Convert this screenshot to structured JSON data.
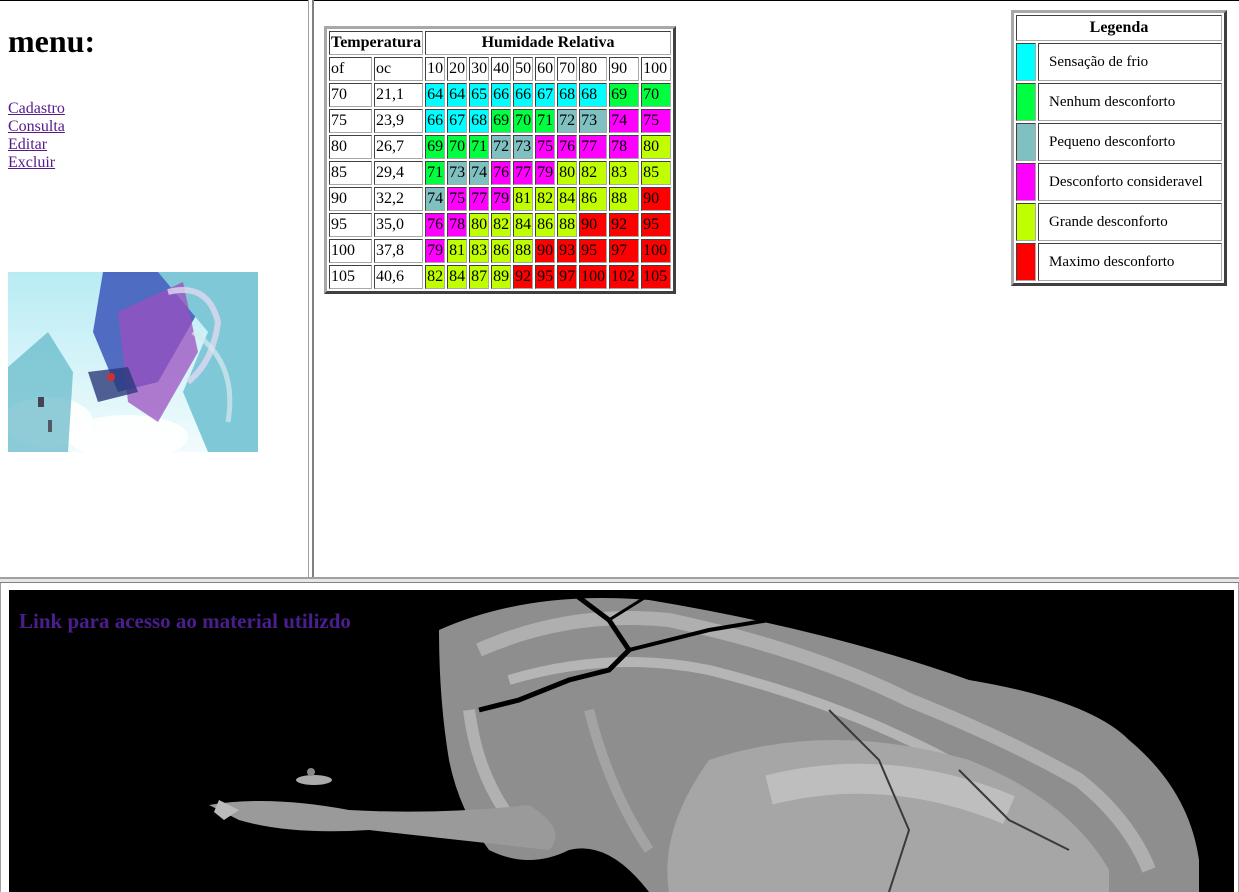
{
  "menu": {
    "title": "menu:",
    "links": [
      "Cadastro",
      "Consulta",
      "Editar",
      "Excluir"
    ]
  },
  "humidity_table": {
    "header_temperature": "Temperatura",
    "header_humidity": "Humidade Relativa",
    "unit_f": "of",
    "unit_c": "oc",
    "humidity_levels": [
      "10",
      "20",
      "30",
      "40",
      "50",
      "60",
      "70",
      "80",
      "90",
      "100"
    ],
    "rows": [
      {
        "f": "70",
        "c": "21,1",
        "values": [
          "64",
          "64",
          "65",
          "66",
          "66",
          "67",
          "68",
          "68",
          "69",
          "70"
        ],
        "levels": [
          0,
          0,
          0,
          0,
          0,
          0,
          0,
          0,
          1,
          1
        ]
      },
      {
        "f": "75",
        "c": "23,9",
        "values": [
          "66",
          "67",
          "68",
          "69",
          "70",
          "71",
          "72",
          "73",
          "74",
          "75"
        ],
        "levels": [
          0,
          0,
          0,
          1,
          1,
          1,
          2,
          2,
          3,
          3
        ]
      },
      {
        "f": "80",
        "c": "26,7",
        "values": [
          "69",
          "70",
          "71",
          "72",
          "73",
          "75",
          "76",
          "77",
          "78",
          "80"
        ],
        "levels": [
          1,
          1,
          1,
          2,
          2,
          3,
          3,
          3,
          3,
          4
        ]
      },
      {
        "f": "85",
        "c": "29,4",
        "values": [
          "71",
          "73",
          "74",
          "76",
          "77",
          "79",
          "80",
          "82",
          "83",
          "85"
        ],
        "levels": [
          1,
          2,
          2,
          3,
          3,
          3,
          4,
          4,
          4,
          4
        ]
      },
      {
        "f": "90",
        "c": "32,2",
        "values": [
          "74",
          "75",
          "77",
          "79",
          "81",
          "82",
          "84",
          "86",
          "88",
          "90"
        ],
        "levels": [
          2,
          3,
          3,
          3,
          4,
          4,
          4,
          4,
          4,
          5
        ]
      },
      {
        "f": "95",
        "c": "35,0",
        "values": [
          "76",
          "78",
          "80",
          "82",
          "84",
          "86",
          "88",
          "90",
          "92",
          "95"
        ],
        "levels": [
          3,
          3,
          4,
          4,
          4,
          4,
          4,
          5,
          5,
          5
        ]
      },
      {
        "f": "100",
        "c": "37,8",
        "values": [
          "79",
          "81",
          "83",
          "86",
          "88",
          "90",
          "93",
          "95",
          "97",
          "100"
        ],
        "levels": [
          3,
          4,
          4,
          4,
          4,
          5,
          5,
          5,
          5,
          5
        ]
      },
      {
        "f": "105",
        "c": "40,6",
        "values": [
          "82",
          "84",
          "87",
          "89",
          "92",
          "95",
          "97",
          "100",
          "102",
          "105"
        ],
        "levels": [
          4,
          4,
          4,
          4,
          5,
          5,
          5,
          5,
          5,
          5
        ]
      }
    ]
  },
  "legend": {
    "title": "Legenda",
    "items": [
      {
        "label": "Sensação de frio",
        "color": "#00ffff"
      },
      {
        "label": "Nenhum desconforto",
        "color": "#00ff40"
      },
      {
        "label": "Pequeno desconforto",
        "color": "#80c0c0"
      },
      {
        "label": "Desconforto consideravel",
        "color": "#ff00ff"
      },
      {
        "label": "Grande desconforto",
        "color": "#c0ff00"
      },
      {
        "label": "Maximo desconforto",
        "color": "#ff0000"
      }
    ]
  },
  "bottom": {
    "link_text": "Link para acesso ao material utilizdo"
  }
}
